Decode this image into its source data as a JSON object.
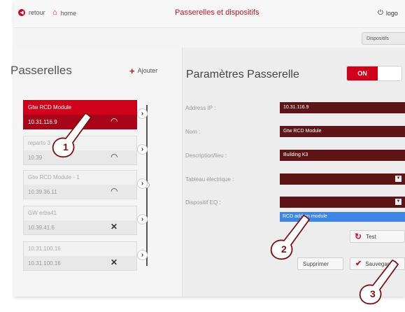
{
  "topbar": {
    "back_label": "retour",
    "home_label": "home",
    "title": "Passerelles et dispositifs",
    "logout_label": "logo"
  },
  "devices_button": "Dispositifs",
  "gateways": {
    "title": "Passerelles",
    "add_label": "Ajouter",
    "items": [
      {
        "name": "Gtw RCD Module",
        "ip": "10.31.116.9",
        "selected": true,
        "wifi": "on"
      },
      {
        "name": "reparto 3",
        "ip": "10.39",
        "selected": false,
        "wifi": "on"
      },
      {
        "name": "Gtw RCD Module - 1",
        "ip": "10.39.36.11",
        "selected": false,
        "wifi": "on"
      },
      {
        "name": "GW erba41",
        "ip": "10.39.41.6",
        "selected": false,
        "wifi": "off"
      },
      {
        "name": "10.31.100.16",
        "ip": "10.31.100.16",
        "selected": false,
        "wifi": "off"
      }
    ]
  },
  "params": {
    "title": "Paramètres Passerelle",
    "toggle_label": "ON",
    "fields": [
      {
        "label": "Address IP :",
        "value": "10.31.116.9"
      },
      {
        "label": "Nom :",
        "value": "Gtw RCD Module"
      },
      {
        "label": "Description/lieu :",
        "value": "Building K3"
      },
      {
        "label": "Tableau électrique :",
        "value": ""
      },
      {
        "label": "Dispositif EQ :",
        "value": ""
      }
    ],
    "dropdown_option": "RCD add-on module",
    "test_label": "Test",
    "delete_label": "Supprimer",
    "save_label": "Sauvegarder"
  },
  "callouts": [
    "1",
    "2",
    "3"
  ],
  "colors": {
    "accent": "#c81420",
    "field_bg": "#5d1518",
    "highlight": "#3d86e6"
  }
}
